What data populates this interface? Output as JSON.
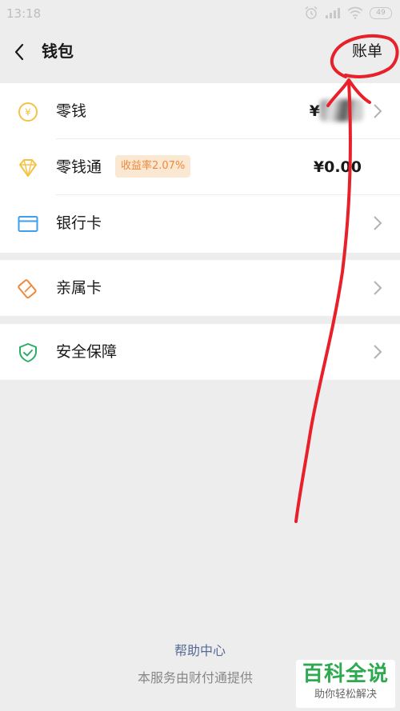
{
  "status_bar": {
    "time": "13:18",
    "battery": "49"
  },
  "nav": {
    "title": "钱包",
    "action": "账单"
  },
  "wallet": {
    "items": [
      {
        "label": "零钱",
        "value": "¥"
      },
      {
        "label": "零钱通",
        "badge": "收益率2.07%",
        "value": "¥0.00"
      },
      {
        "label": "银行卡"
      },
      {
        "label": "亲属卡"
      },
      {
        "label": "安全保障"
      }
    ]
  },
  "footer": {
    "help_link": "帮助中心",
    "provider_note": "本服务由财付通提供"
  },
  "watermark": {
    "title": "百科全说",
    "subtitle": "助你轻松解决"
  },
  "colors": {
    "accent_yellow": "#f6c243",
    "accent_orange": "#f0883a",
    "accent_blue": "#3e9ff0",
    "accent_green": "#2aae67",
    "link_blue": "#576b95",
    "annotation_red": "#e8202a"
  }
}
